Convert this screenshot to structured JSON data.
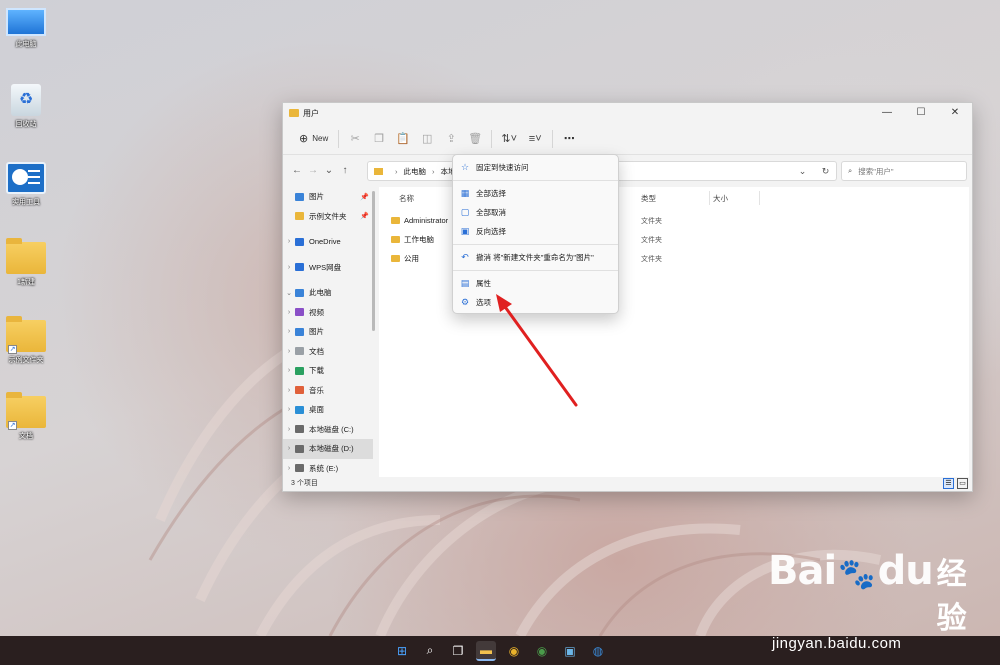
{
  "desktop": {
    "icons": [
      {
        "label": "此电脑",
        "kind": "monitor"
      },
      {
        "label": "回收站",
        "kind": "recycle"
      },
      {
        "label": "实用工具",
        "kind": "app"
      },
      {
        "label": "1新建",
        "kind": "folder"
      },
      {
        "label": "示例文件夹",
        "kind": "folder-shortcut"
      },
      {
        "label": "文档",
        "kind": "folder-shortcut"
      }
    ]
  },
  "window": {
    "title": "用户",
    "controls": {
      "minimize": "—",
      "maximize": "☐",
      "close": "✕"
    },
    "toolbar": {
      "new_label": "New",
      "icons": [
        "cut-icon",
        "copy-icon",
        "paste-icon",
        "rename-icon",
        "share-icon",
        "delete-icon"
      ],
      "sort_glyph": "⇅",
      "view_glyph": "≡",
      "more_glyph": "⋯"
    },
    "nav": {
      "back": "←",
      "forward": "→",
      "recent": "⌄",
      "up": "↑"
    },
    "address": {
      "segments": [
        "此电脑",
        "本地磁"
      ],
      "separator": "›",
      "dropdown_glyph": "⌄",
      "refresh_glyph": "↻"
    },
    "search": {
      "placeholder": "搜索\"用户\"",
      "glyph": "⌕"
    },
    "sidebar": {
      "items": [
        {
          "label": "图片",
          "expand": "",
          "icon_color": "#3a83d8",
          "pinned": true,
          "pin_glyph": "📌"
        },
        {
          "label": "示例文件夹",
          "expand": "",
          "icon_color": "#eab63a",
          "pinned": true,
          "pin_glyph": "📌"
        },
        {
          "gap": true
        },
        {
          "label": "OneDrive",
          "expand": "›",
          "icon_color": "#2a6fd6"
        },
        {
          "gap": true
        },
        {
          "label": "WPS网盘",
          "expand": "›",
          "icon_color": "#2a6fd6"
        },
        {
          "gap": true
        },
        {
          "label": "此电脑",
          "expand": "⌄",
          "icon_color": "#3a83d8"
        },
        {
          "label": "视频",
          "expand": "›",
          "icon_color": "#8a4fc7"
        },
        {
          "label": "图片",
          "expand": "›",
          "icon_color": "#3a83d8"
        },
        {
          "label": "文档",
          "expand": "›",
          "icon_color": "#9aa0a6"
        },
        {
          "label": "下载",
          "expand": "›",
          "icon_color": "#2aa060"
        },
        {
          "label": "音乐",
          "expand": "›",
          "icon_color": "#e0603a"
        },
        {
          "label": "桌面",
          "expand": "›",
          "icon_color": "#2a8fd6"
        },
        {
          "label": "本地磁盘 (C:)",
          "expand": "›",
          "icon_color": "#6a6a6a"
        },
        {
          "label": "本地磁盘 (D:)",
          "expand": "›",
          "icon_color": "#6a6a6a",
          "selected": true
        },
        {
          "label": "系统 (E:)",
          "expand": "›",
          "icon_color": "#6a6a6a"
        }
      ]
    },
    "columns": {
      "name": "名称",
      "type": "类型",
      "size": "大小"
    },
    "files": [
      {
        "name": "Administrator",
        "type": "文件夹"
      },
      {
        "name": "工作电脑",
        "type": "文件夹"
      },
      {
        "name": "公用",
        "type": "文件夹"
      }
    ],
    "status": "3 个项目",
    "view_buttons": {
      "details": "☰",
      "tiles": "▭"
    }
  },
  "context_menu": {
    "items": [
      {
        "glyph": "☆",
        "label": "固定到快速访问"
      },
      {
        "sep": true
      },
      {
        "glyph": "▦",
        "label": "全部选择"
      },
      {
        "glyph": "▢",
        "label": "全部取消"
      },
      {
        "glyph": "▣",
        "label": "反向选择"
      },
      {
        "sep": true
      },
      {
        "glyph": "↶",
        "label": "撤消 将\"新建文件夹\"重命名为\"图片\""
      },
      {
        "sep": true
      },
      {
        "glyph": "▤",
        "label": "属性"
      },
      {
        "glyph": "⚙",
        "label": "选项"
      }
    ]
  },
  "annotation": {
    "arrow_color": "#e02020"
  },
  "taskbar": {
    "apps": [
      {
        "name": "start-icon",
        "glyph": "⊞",
        "color": "#4aa3ff"
      },
      {
        "name": "search-icon",
        "glyph": "⌕",
        "color": "#ffffff"
      },
      {
        "name": "task-view-icon",
        "glyph": "❐",
        "color": "#ffffff"
      },
      {
        "name": "file-explorer-icon",
        "glyph": "▬",
        "color": "#f2c14e",
        "active": true
      },
      {
        "name": "chrome-icon",
        "glyph": "◉",
        "color": "#e8b12b"
      },
      {
        "name": "chrome-alt-icon",
        "glyph": "◉",
        "color": "#4a9b4a"
      },
      {
        "name": "remote-desktop-icon",
        "glyph": "▣",
        "color": "#6cb6e8"
      },
      {
        "name": "browser-icon",
        "glyph": "◍",
        "color": "#3a8ad8"
      }
    ]
  },
  "watermark": {
    "brand": "Bai",
    "brand2": "du",
    "jingyan": "经验",
    "url": "jingyan.baidu.com"
  }
}
